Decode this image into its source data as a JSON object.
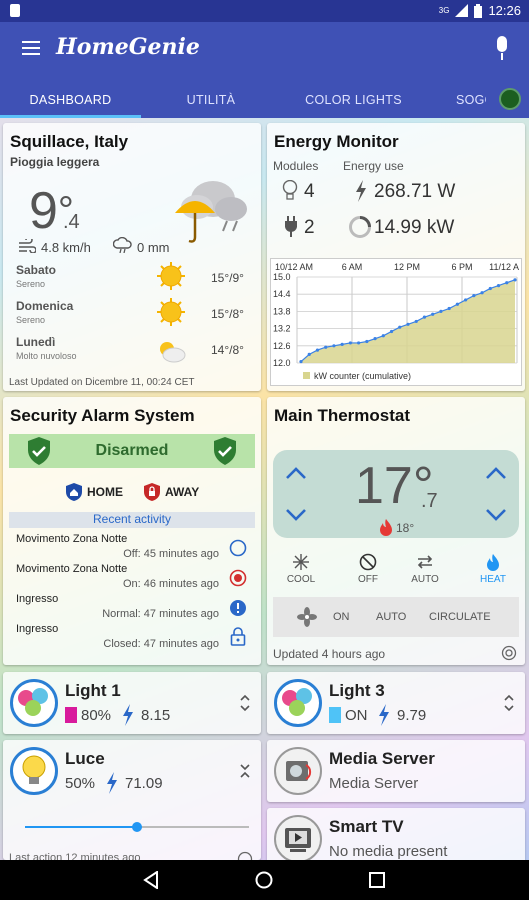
{
  "status_bar": {
    "network": "3G",
    "time": "12:26"
  },
  "app": {
    "title": "HomeGenie"
  },
  "tabs": [
    {
      "label": "DASHBOARD"
    },
    {
      "label": "UTILITÀ"
    },
    {
      "label": "COLOR LIGHTS"
    },
    {
      "label": "SOGG"
    }
  ],
  "weather": {
    "location": "Squillace, Italy",
    "condition": "Pioggia leggera",
    "temp_int": "9",
    "temp_dec": ".4",
    "wind": "4.8 km/h",
    "rain": "0 mm",
    "forecast": [
      {
        "day": "Sabato",
        "desc": "Sereno",
        "temps": "15°/9°",
        "icon": "sun-icon"
      },
      {
        "day": "Domenica",
        "desc": "Sereno",
        "temps": "15°/8°",
        "icon": "sun-icon"
      },
      {
        "day": "Lunedì",
        "desc": "Molto nuvoloso",
        "temps": "14°/8°",
        "icon": "cloud-sun-icon"
      }
    ],
    "updated": "Last Updated on Dicembre 11, 00:24 CET"
  },
  "energy": {
    "title": "Energy Monitor",
    "modules_label": "Modules",
    "energy_label": "Energy use",
    "lights_count": "4",
    "power": "268.71 W",
    "plugs_count": "2",
    "total": "14.99 kW",
    "legend": "kW counter (cumulative)",
    "colors": {
      "line": "#3b82e6",
      "fill": "#d8d58f"
    }
  },
  "chart_data": {
    "type": "area",
    "title": "",
    "x_tick_labels": [
      "10/12 AM",
      "6 AM",
      "12 PM",
      "6 PM",
      "11/12 A"
    ],
    "y_tick_labels": [
      "15.0",
      "14.4",
      "13.8",
      "13.2",
      "12.6",
      "12.0"
    ],
    "ylim": [
      12.0,
      15.0
    ],
    "grid": true,
    "legend": "bottom-left",
    "series": [
      {
        "name": "kW counter (cumulative)",
        "values": [
          12.05,
          12.3,
          12.45,
          12.55,
          12.6,
          12.65,
          12.7,
          12.7,
          12.75,
          12.85,
          12.95,
          13.1,
          13.25,
          13.35,
          13.45,
          13.6,
          13.7,
          13.8,
          13.9,
          14.05,
          14.2,
          14.35,
          14.45,
          14.6,
          14.7,
          14.8,
          14.9
        ]
      }
    ]
  },
  "security": {
    "title": "Security Alarm System",
    "status": "Disarmed",
    "home_label": "HOME",
    "away_label": "AWAY",
    "recent_label": "Recent activity",
    "events": [
      {
        "name": "Movimento Zona Notte",
        "detail": "Off: 45 minutes ago",
        "icon": "circle-outline-icon"
      },
      {
        "name": "Movimento Zona Notte",
        "detail": "On: 46 minutes ago",
        "icon": "record-icon"
      },
      {
        "name": "Ingresso",
        "detail": "Normal: 47 minutes ago",
        "icon": "info-alert-icon"
      },
      {
        "name": "Ingresso",
        "detail": "Closed: 47 minutes ago",
        "icon": "lock-icon"
      }
    ]
  },
  "thermostat": {
    "title": "Main Thermostat",
    "temp_int": "17°",
    "temp_dec": ".7",
    "setpoint": "18°",
    "modes": [
      {
        "label": "COOL",
        "icon": "snowflake-icon"
      },
      {
        "label": "OFF",
        "icon": "off-icon"
      },
      {
        "label": "AUTO",
        "icon": "auto-icon"
      },
      {
        "label": "HEAT",
        "icon": "flame-icon"
      }
    ],
    "fan_modes": [
      "ON",
      "AUTO",
      "CIRCULATE"
    ],
    "updated": "Updated 4 hours ago"
  },
  "light1": {
    "title": "Light 1",
    "level": "80%",
    "power": "8.15",
    "color": "#d81b9c"
  },
  "light3": {
    "title": "Light 3",
    "level": "ON",
    "power": "9.79",
    "color": "#4fc3f7"
  },
  "luce": {
    "title": "Luce",
    "level": "50%",
    "power": "71.09",
    "slider": 0.5,
    "last": "Last action 12 minutes ago"
  },
  "media_server": {
    "title": "Media Server",
    "subtitle": "Media Server"
  },
  "smart_tv": {
    "title": "Smart TV",
    "subtitle": "No media present"
  }
}
